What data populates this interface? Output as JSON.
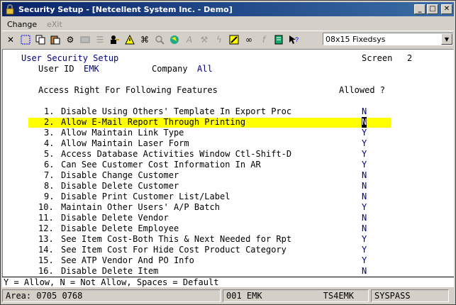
{
  "window": {
    "title": "Security Setup - [Netcellent System Inc. - Demo]"
  },
  "titlebar_buttons": {
    "minimize": "_",
    "maximize": "□",
    "close": "✕"
  },
  "menu": [
    {
      "label": "Change",
      "enabled": true
    },
    {
      "label": "eXit",
      "enabled": false
    }
  ],
  "toolbar": {
    "icons": [
      "close-x-icon",
      "select-icon",
      "copy-icon",
      "paste-icon",
      "settings-icon",
      "print-preview-icon",
      "list-icon",
      "user-key-icon",
      "warning-icon",
      "binoculars-icon",
      "search-icon",
      "globe-icon",
      "script-a-icon",
      "tool-icon",
      "flash-icon",
      "pen-icon",
      "link-icon",
      "fx-icon",
      "note-icon",
      "help-cursor-icon"
    ],
    "font": "08x15 Fixedsys"
  },
  "screen": {
    "title": "User Security Setup",
    "screen_label": "Screen",
    "screen_no": "2",
    "user_id_label": "User ID",
    "user_id": "EMK",
    "company_label": "Company",
    "company": "All",
    "access_heading": "Access Right For Following Features",
    "allowed_heading": "Allowed ?",
    "rows": [
      {
        "no": "1.",
        "label": "Disable Using Others' Template In Export Proc",
        "value": "N"
      },
      {
        "no": "2.",
        "label": "Allow E-Mail Report Through Printing",
        "value": "N"
      },
      {
        "no": "3.",
        "label": "Allow Maintain Link Type",
        "value": "Y"
      },
      {
        "no": "4.",
        "label": "Allow Maintain Laser Form",
        "value": "Y"
      },
      {
        "no": "5.",
        "label": "Access Database Activities Window Ctl-Shift-D",
        "value": "Y"
      },
      {
        "no": "6.",
        "label": "Can See Customer Cost Information In AR",
        "value": "Y"
      },
      {
        "no": "7.",
        "label": "Disable Change Customer",
        "value": "N"
      },
      {
        "no": "8.",
        "label": "Disable Delete Customer",
        "value": "N"
      },
      {
        "no": "9.",
        "label": "Disable Print Customer List/Label",
        "value": "N"
      },
      {
        "no": "10.",
        "label": "Maintain Other Users' A/P Batch",
        "value": "Y"
      },
      {
        "no": "11.",
        "label": "Disable Delete Vendor",
        "value": "N"
      },
      {
        "no": "12.",
        "label": "Disable Delete Employee",
        "value": "N"
      },
      {
        "no": "13.",
        "label": "See Item Cost-Both This & Next Needed for Rpt",
        "value": "Y"
      },
      {
        "no": "14.",
        "label": "See Item Cost For Hide Cost Product Category",
        "value": "Y"
      },
      {
        "no": "15.",
        "label": "See ATP Vendor And PO Info",
        "value": "Y"
      },
      {
        "no": "16.",
        "label": "Disable Delete Item",
        "value": "N"
      }
    ],
    "highlight_color": "#ffff00"
  },
  "hint": "Y = Allow, N = Not Allow, Spaces = Default",
  "status": {
    "area": "Area: 0705 0768",
    "user": "001 EMK",
    "terminal": "TS4EMK",
    "password": "SYSPASS"
  }
}
